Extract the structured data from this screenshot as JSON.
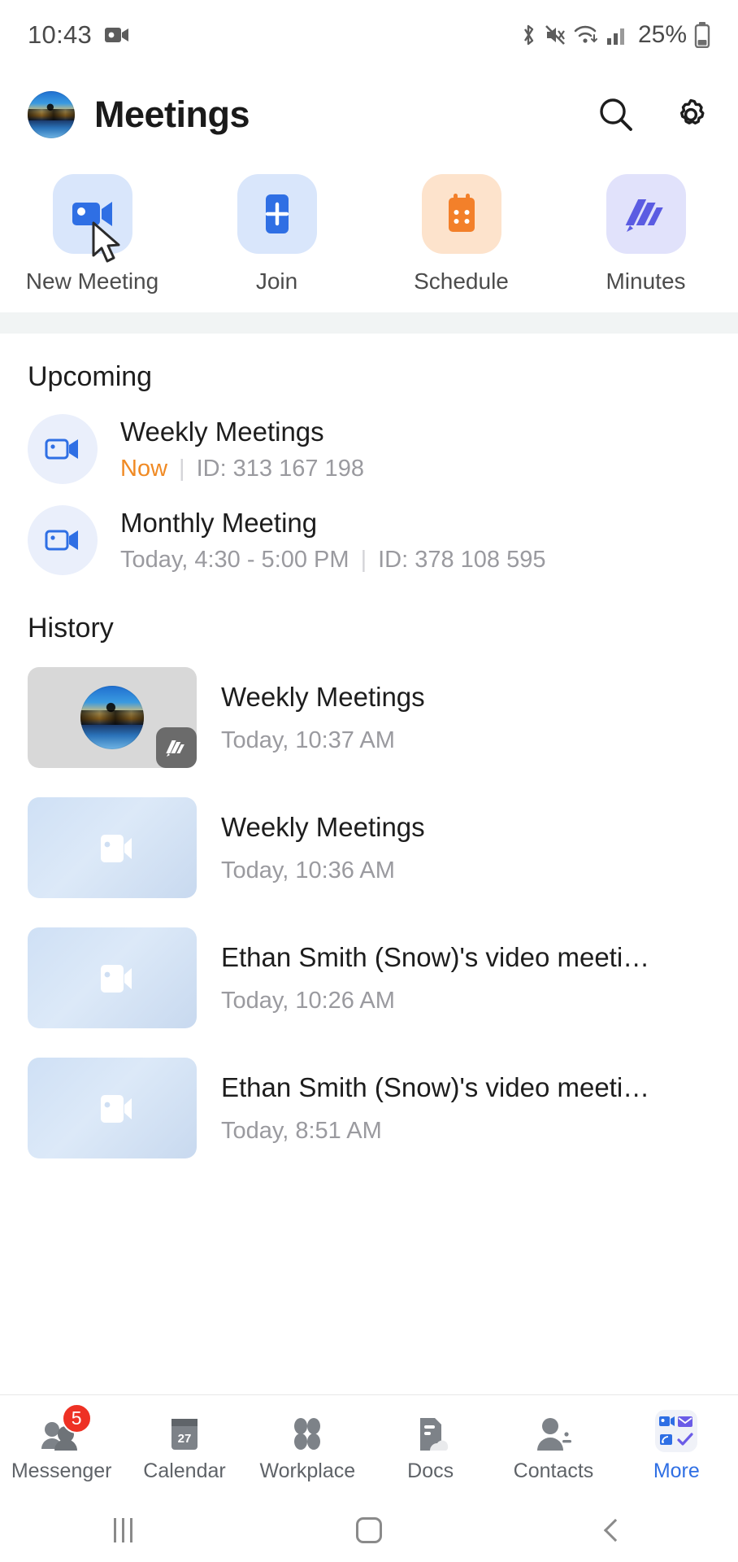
{
  "status_bar": {
    "time": "10:43",
    "battery_percent": "25%",
    "icons": [
      "video-record-icon",
      "bluetooth-icon",
      "mute-icon",
      "wifi-icon",
      "signal-icon",
      "battery-icon"
    ]
  },
  "header": {
    "title": "Meetings",
    "avatar_name": "user-avatar",
    "search_icon": "search-icon",
    "settings_icon": "gear-icon"
  },
  "quick_actions": [
    {
      "label": "New Meeting",
      "icon": "video-camera-icon",
      "tile_color": "#d9e6fb",
      "icon_color": "#2f6fe4"
    },
    {
      "label": "Join",
      "icon": "plus-square-icon",
      "tile_color": "#d9e6fb",
      "icon_color": "#2f6fe4"
    },
    {
      "label": "Schedule",
      "icon": "calendar-icon",
      "tile_color": "#fde3cc",
      "icon_color": "#f3802a"
    },
    {
      "label": "Minutes",
      "icon": "minutes-icon",
      "tile_color": "#e1e2fb",
      "icon_color": "#5b5ce2"
    }
  ],
  "upcoming": {
    "section_title": "Upcoming",
    "items": [
      {
        "name": "Weekly Meetings",
        "status": "Now",
        "separator": "|",
        "id": "ID: 313 167 198",
        "icon": "video-camera-icon"
      },
      {
        "name": "Monthly Meeting",
        "status": "Today, 4:30 - 5:00 PM",
        "separator": "|",
        "id": "ID: 378 108 595",
        "icon": "video-camera-icon"
      }
    ]
  },
  "history": {
    "section_title": "History",
    "items": [
      {
        "name": "Weekly Meetings",
        "time": "Today, 10:37 AM",
        "thumb": "avatar-thumbnail",
        "badge": "minutes-badge"
      },
      {
        "name": "Weekly Meetings",
        "time": "Today, 10:36 AM",
        "thumb": "video-thumbnail",
        "badge": ""
      },
      {
        "name": "Ethan Smith (Snow)'s video meeti…",
        "time": "Today, 10:26 AM",
        "thumb": "video-thumbnail",
        "badge": ""
      },
      {
        "name": "Ethan Smith (Snow)'s video meeti…",
        "time": "Today, 8:51 AM",
        "thumb": "video-thumbnail",
        "badge": ""
      }
    ]
  },
  "bottom_nav": {
    "active": "More",
    "items": [
      {
        "label": "Messenger",
        "icon": "messenger-icon",
        "badge": "5"
      },
      {
        "label": "Calendar",
        "icon": "calendar-icon",
        "badge": "",
        "day": "27"
      },
      {
        "label": "Workplace",
        "icon": "workplace-icon",
        "badge": ""
      },
      {
        "label": "Docs",
        "icon": "docs-icon",
        "badge": ""
      },
      {
        "label": "Contacts",
        "icon": "contacts-icon",
        "badge": ""
      },
      {
        "label": "More",
        "icon": "more-grid-icon",
        "badge": ""
      }
    ]
  },
  "system_nav": {
    "recents": "recents-icon",
    "home": "home-icon",
    "back": "back-icon"
  },
  "colors": {
    "accent_blue": "#2f6fe4",
    "orange": "#f08a24",
    "badge_red": "#ee3124",
    "muted_text": "#9a9a9f"
  }
}
